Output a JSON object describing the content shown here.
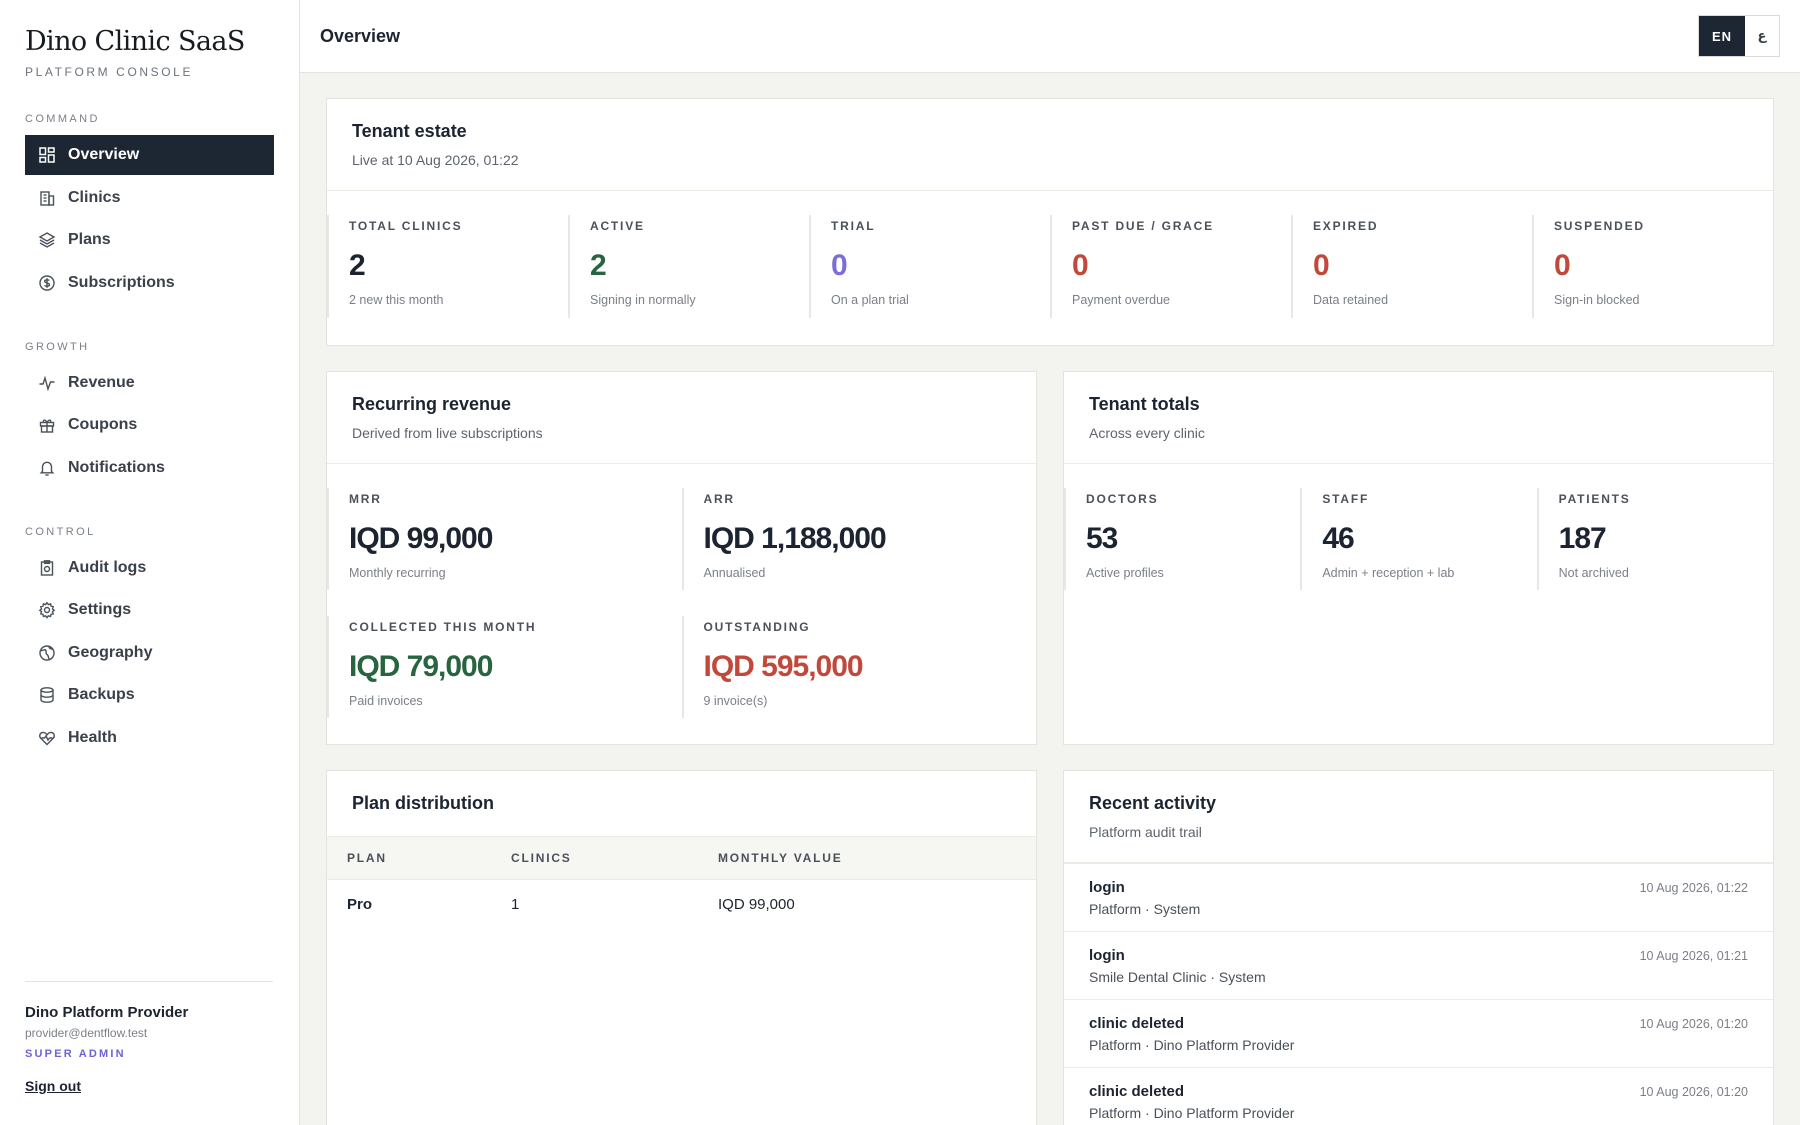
{
  "sidebar": {
    "brand": "Dino Clinic SaaS",
    "brand_sub": "PLATFORM CONSOLE",
    "groups": [
      {
        "label": "COMMAND",
        "items": [
          {
            "label": "Overview",
            "icon": "grid-icon",
            "active": true
          },
          {
            "label": "Clinics",
            "icon": "building-icon"
          },
          {
            "label": "Plans",
            "icon": "layers-icon"
          },
          {
            "label": "Subscriptions",
            "icon": "dollar-circle-icon"
          }
        ]
      },
      {
        "label": "GROWTH",
        "items": [
          {
            "label": "Revenue",
            "icon": "pulse-icon"
          },
          {
            "label": "Coupons",
            "icon": "gift-icon"
          },
          {
            "label": "Notifications",
            "icon": "bell-icon"
          }
        ]
      },
      {
        "label": "CONTROL",
        "items": [
          {
            "label": "Audit logs",
            "icon": "clipboard-icon"
          },
          {
            "label": "Settings",
            "icon": "gear-icon"
          },
          {
            "label": "Geography",
            "icon": "globe-icon"
          },
          {
            "label": "Backups",
            "icon": "database-icon"
          },
          {
            "label": "Health",
            "icon": "heart-icon"
          }
        ]
      }
    ],
    "user": {
      "name": "Dino Platform Provider",
      "email": "provider@dentflow.test",
      "role": "SUPER ADMIN",
      "sign_out": "Sign out"
    }
  },
  "topbar": {
    "title": "Overview",
    "lang_active": "EN",
    "lang_other": "ع"
  },
  "estate": {
    "title": "Tenant estate",
    "subtitle": "Live at 10 Aug 2026, 01:22",
    "stats": [
      {
        "label": "TOTAL CLINICS",
        "value": "2",
        "note": "2 new this month",
        "color": "#1b2430"
      },
      {
        "label": "ACTIVE",
        "value": "2",
        "note": "Signing in normally",
        "color": "#27643f"
      },
      {
        "label": "TRIAL",
        "value": "0",
        "note": "On a plan trial",
        "color": "#7c6ddd"
      },
      {
        "label": "PAST DUE / GRACE",
        "value": "0",
        "note": "Payment overdue",
        "color": "#c2483b"
      },
      {
        "label": "EXPIRED",
        "value": "0",
        "note": "Data retained",
        "color": "#c2483b"
      },
      {
        "label": "SUSPENDED",
        "value": "0",
        "note": "Sign-in blocked",
        "color": "#c2483b"
      }
    ]
  },
  "revenue": {
    "title": "Recurring revenue",
    "subtitle": "Derived from live subscriptions",
    "cells": [
      {
        "label": "MRR",
        "value": "IQD 99,000",
        "note": "Monthly recurring",
        "color": "#1b2430"
      },
      {
        "label": "ARR",
        "value": "IQD 1,188,000",
        "note": "Annualised",
        "color": "#1b2430"
      },
      {
        "label": "COLLECTED THIS MONTH",
        "value": "IQD 79,000",
        "note": "Paid invoices",
        "color": "#27643f"
      },
      {
        "label": "OUTSTANDING",
        "value": "IQD 595,000",
        "note": "9 invoice(s)",
        "color": "#c2483b"
      }
    ]
  },
  "totals": {
    "title": "Tenant totals",
    "subtitle": "Across every clinic",
    "cells": [
      {
        "label": "DOCTORS",
        "value": "53",
        "note": "Active profiles"
      },
      {
        "label": "STAFF",
        "value": "46",
        "note": "Admin + reception + lab"
      },
      {
        "label": "PATIENTS",
        "value": "187",
        "note": "Not archived"
      }
    ]
  },
  "plans": {
    "title": "Plan distribution",
    "columns": [
      "PLAN",
      "CLINICS",
      "MONTHLY VALUE"
    ],
    "rows": [
      {
        "plan": "Pro",
        "clinics": "1",
        "value": "IQD 99,000"
      }
    ]
  },
  "activity": {
    "title": "Recent activity",
    "subtitle": "Platform audit trail",
    "items": [
      {
        "title": "login",
        "meta": "Platform · System",
        "time": "10 Aug 2026, 01:22"
      },
      {
        "title": "login",
        "meta": "Smile Dental Clinic · System",
        "time": "10 Aug 2026, 01:21"
      },
      {
        "title": "clinic deleted",
        "meta": "Platform · Dino Platform Provider",
        "time": "10 Aug 2026, 01:20"
      },
      {
        "title": "clinic deleted",
        "meta": "Platform · Dino Platform Provider",
        "time": "10 Aug 2026, 01:20"
      }
    ]
  }
}
